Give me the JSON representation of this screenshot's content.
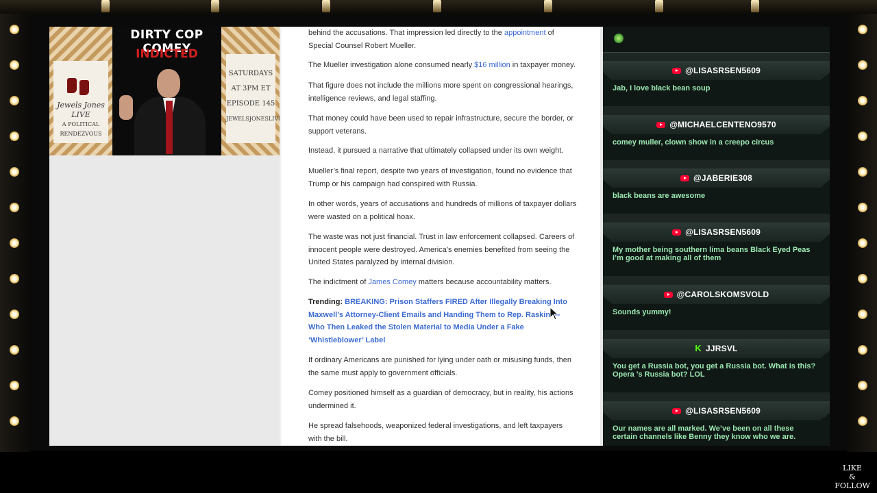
{
  "thumbnail": {
    "title": "DIRTY COP COMEY",
    "subtitle": "INDICTED",
    "show_name": "Jewels Jones LIVE",
    "show_tagline": "A POLITICAL RENDEZVOUS",
    "schedule": "SATURDAYS AT 3PM ET",
    "episode": "EPISODE 145",
    "site": "JEWELSJONESLIVE.COM"
  },
  "article": {
    "p1_a": "behind the accusations. That impression led directly to the ",
    "p1_link": "appointment",
    "p1_b": " of Special Counsel Robert Mueller.",
    "p2_a": "The Mueller investigation alone consumed nearly ",
    "p2_link": "$16 million",
    "p2_b": " in taxpayer money.",
    "p3": "That figure does not include the millions more spent on congressional hearings, intelligence reviews, and legal staffing.",
    "p4": "That money could have been used to repair infrastructure, secure the border, or support veterans.",
    "p5": "Instead, it pursued a narrative that ultimately collapsed under its own weight.",
    "p6": "Mueller’s final report, despite two years of investigation, found no evidence that Trump or his campaign had conspired with Russia.",
    "p7": "In other words, years of accusations and hundreds of millions of taxpayer dollars were wasted on a political hoax.",
    "p8": "The waste was not just financial. Trust in law enforcement collapsed. Careers of innocent people were destroyed. America’s enemies benefited from seeing the United States paralyzed by internal division.",
    "p9_a": "The indictment of ",
    "p9_link": "James Comey",
    "p9_b": " matters because accountability matters.",
    "trending_label": "Trending:",
    "trending_link": "BREAKING: Prison Staffers FIRED After Illegally Breaking Into Maxwell’s Attorney-Client Emails and Handing Them to Rep. Raskin — Who Then Leaked the Stolen Material to Media Under a Fake ‘Whistleblower’ Label",
    "p10": "If ordinary Americans are punished for lying under oath or misusing funds, then the same must apply to government officials.",
    "p11": "Comey positioned himself as a guardian of democracy, but in reality, his actions undermined it.",
    "p12": "He spread falsehoods, weaponized federal investigations, and left taxpayers with the bill."
  },
  "chat": {
    "messages": [
      {
        "platform": "youtube",
        "user": "@LISASRSEN5609",
        "text": "Jab, I love black bean soup"
      },
      {
        "platform": "youtube",
        "user": "@MICHAELCENTENO9570",
        "text": "comey muller, clown show in a creepo circus"
      },
      {
        "platform": "youtube",
        "user": "@JABERIE308",
        "text": "black beans are awesome"
      },
      {
        "platform": "youtube",
        "user": "@LISASRSEN5609",
        "text": "My mother being southern lima beans Black Eyed Peas I’m good at making all of them"
      },
      {
        "platform": "youtube",
        "user": "@CAROLSKOMSVOLD",
        "text": "Sounds yummy!"
      },
      {
        "platform": "kick",
        "user": "JJRSVL",
        "text": "You get a Russia bot, you get a Russia bot. What is this? Opera 's Russia bot? LOL"
      },
      {
        "platform": "youtube",
        "user": "@LISASRSEN5609",
        "text": "Our names are all marked. We’ve been on all these certain channels like Benny they know who we are."
      }
    ]
  },
  "overlay": {
    "like": "LIKE",
    "amp": "&",
    "follow": "FOLLOW"
  },
  "colors": {
    "link": "#3c6bd1",
    "chat_text": "#9be7b0",
    "chat_bg": "#1d2622",
    "youtube": "#ff0033",
    "kick": "#53fc18"
  }
}
